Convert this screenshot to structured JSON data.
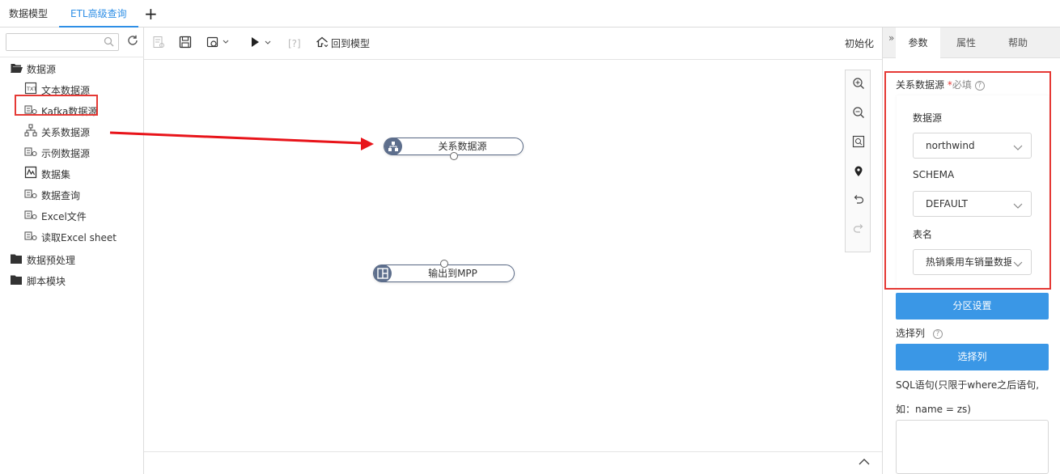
{
  "tabs": [
    {
      "label": "数据模型"
    },
    {
      "label": "ETL高级查询"
    }
  ],
  "add_tab": "+",
  "sidebar": {
    "search_placeholder": "",
    "tree": [
      {
        "label": "数据源",
        "icon": "folder-open-icon"
      },
      {
        "label": "文本数据源",
        "icon": "text-file-icon"
      },
      {
        "label": "Kafka数据源",
        "icon": "datasource-icon"
      },
      {
        "label": "关系数据源",
        "icon": "relational-icon"
      },
      {
        "label": "示例数据源",
        "icon": "datasource-icon"
      },
      {
        "label": "数据集",
        "icon": "dataset-icon"
      },
      {
        "label": "数据查询",
        "icon": "datasource-icon"
      },
      {
        "label": "Excel文件",
        "icon": "datasource-icon"
      },
      {
        "label": "读取Excel sheet",
        "icon": "datasource-icon"
      },
      {
        "label": "数据预处理",
        "icon": "folder-icon"
      },
      {
        "label": "脚本模块",
        "icon": "folder-icon"
      }
    ]
  },
  "toolbar": {
    "help": "[?]",
    "back_to_model": "回到模型",
    "init": "初始化"
  },
  "canvas": {
    "nodes": [
      {
        "label": "关系数据源"
      },
      {
        "label": "输出到MPP"
      }
    ]
  },
  "right_panel": {
    "expand": "»",
    "tabs": [
      {
        "label": "参数"
      },
      {
        "label": "属性"
      },
      {
        "label": "帮助"
      }
    ],
    "section_title": "关系数据源",
    "required_star": "*",
    "required_text": "必填",
    "fields": [
      {
        "label": "数据源",
        "value": "northwind"
      },
      {
        "label": "SCHEMA",
        "value": "DEFAULT"
      },
      {
        "label": "表名",
        "value": "热销乘用车销量数据"
      }
    ],
    "partition_button": "分区设置",
    "select_columns_label": "选择列",
    "select_columns_button": "选择列",
    "sql_label_line1": "SQL语句(只限于where之后语句,",
    "sql_label_line2": "如：name = zs)",
    "sql_value": ""
  },
  "colors": {
    "accent": "#2f8fe6",
    "button": "#3a97e6",
    "highlight": "#e53935",
    "node_icon": "#5d6e8c"
  }
}
